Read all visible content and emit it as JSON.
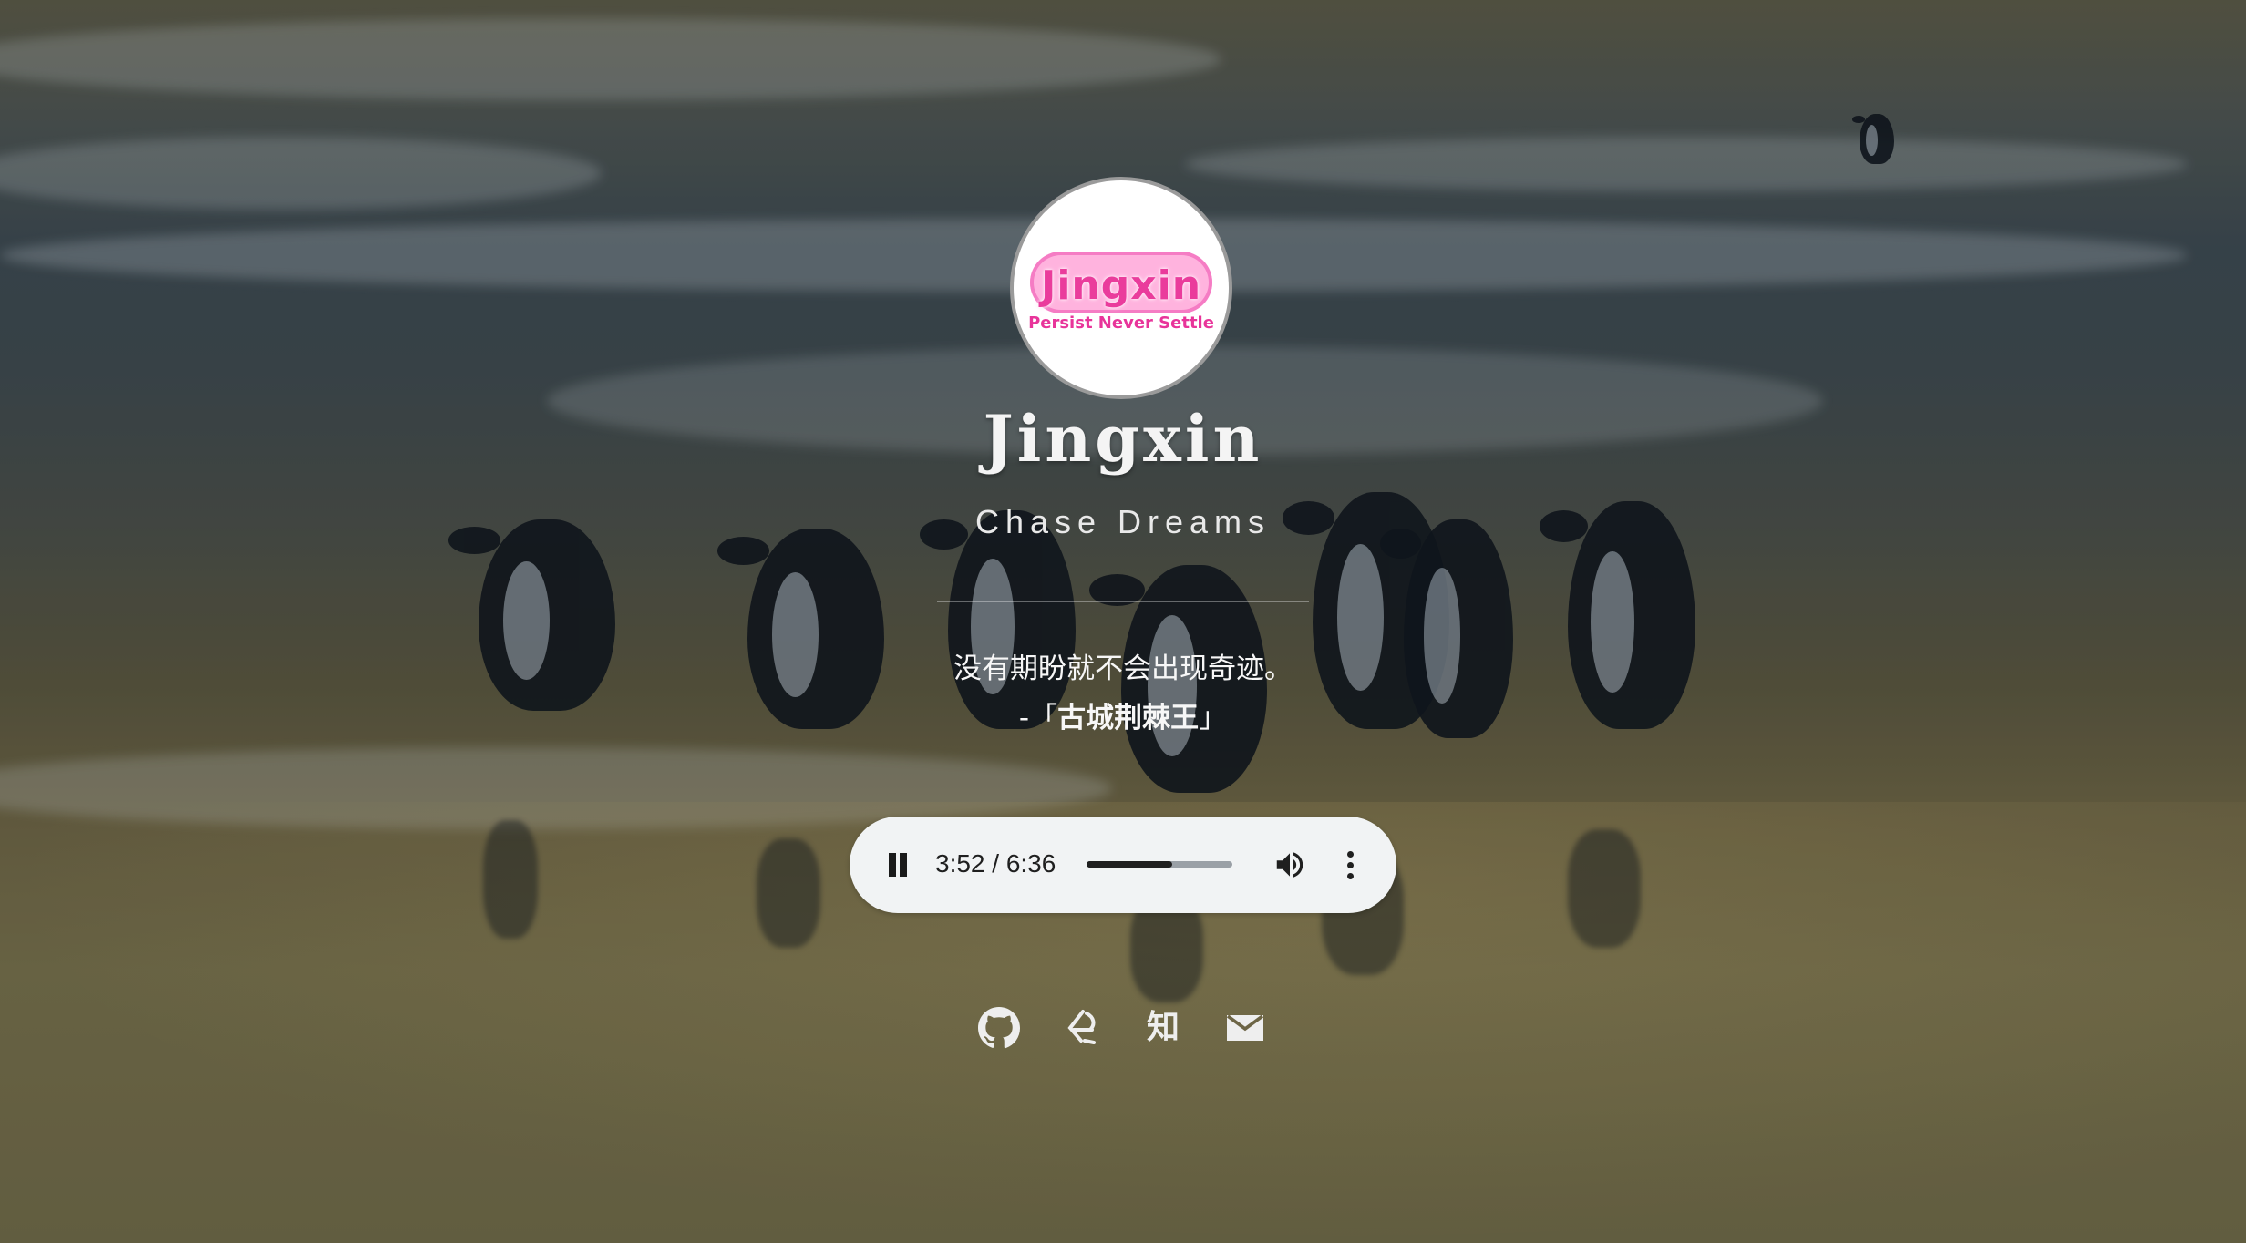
{
  "profile": {
    "avatar_title": "Jingxin",
    "avatar_subtitle": "Persist Never Settle",
    "name": "Jingxin",
    "tagline": "Chase Dreams"
  },
  "quote": {
    "text": "没有期盼就不会出现奇迹。",
    "prefix": "-「",
    "source": "古城荆棘王",
    "suffix": "」"
  },
  "audio_player": {
    "state": "playing",
    "time_display": "3:52 / 6:36",
    "current_time": "3:52",
    "duration": "6:36",
    "progress_fraction": 0.585
  },
  "social_links": [
    {
      "name": "github-icon",
      "label": "GitHub"
    },
    {
      "name": "leetcode-icon",
      "label": "LeetCode"
    },
    {
      "name": "zhihu-icon",
      "label": "知"
    },
    {
      "name": "email-icon",
      "label": "Email"
    }
  ],
  "colors": {
    "text": "#f4f4f4",
    "player_bg": "#f1f3f4",
    "avatar_pink": "#ea3c9c"
  }
}
